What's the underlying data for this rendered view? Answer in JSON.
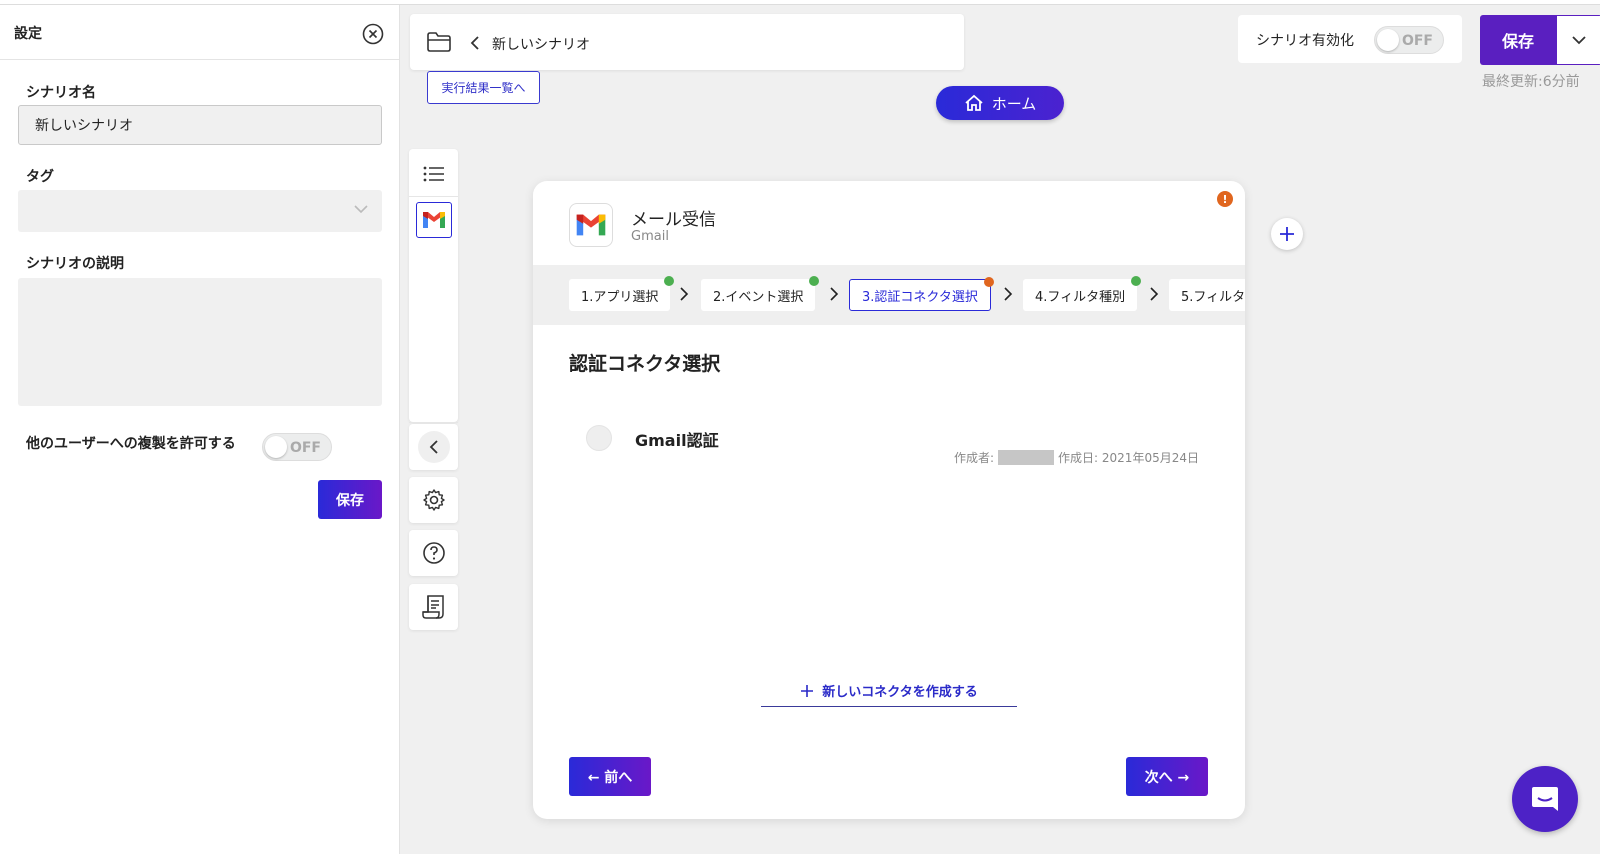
{
  "settings": {
    "title": "設定",
    "scenario_name_label": "シナリオ名",
    "scenario_name_value": "新しいシナリオ",
    "tag_label": "タグ",
    "description_label": "シナリオの説明",
    "allow_copy_label": "他のユーザーへの複製を許可する",
    "allow_copy_toggle": "OFF",
    "save_label": "保存"
  },
  "header": {
    "scenario_title": "新しいシナリオ",
    "results_link": "実行結果一覧へ",
    "home_label": "ホーム"
  },
  "topright": {
    "enable_label": "シナリオ有効化",
    "enable_toggle": "OFF",
    "save_label": "保存",
    "last_updated": "最終更新:6分前"
  },
  "card": {
    "app_title": "メール受信",
    "app_subtitle": "Gmail",
    "steps": [
      {
        "label": "1.アプリ選択",
        "status": "done"
      },
      {
        "label": "2.イベント選択",
        "status": "done"
      },
      {
        "label": "3.認証コネクタ選択",
        "status": "warning"
      },
      {
        "label": "4.フィルタ種別",
        "status": "done"
      },
      {
        "label": "5.フィルタ",
        "status": "none"
      }
    ],
    "section_title": "認証コネクタ選択",
    "connector_name": "Gmail認証",
    "created_by_label": "作成者:",
    "created_date": "作成日: 2021年05月24日",
    "new_connector_label": "新しいコネクタを作成する",
    "prev_label": "← 前へ",
    "next_label": "次へ →"
  },
  "colors": {
    "accent": "#2a2ad8",
    "brand_purple": "#5a1fc0",
    "ok": "#4caf50",
    "warning": "#e0661f"
  }
}
